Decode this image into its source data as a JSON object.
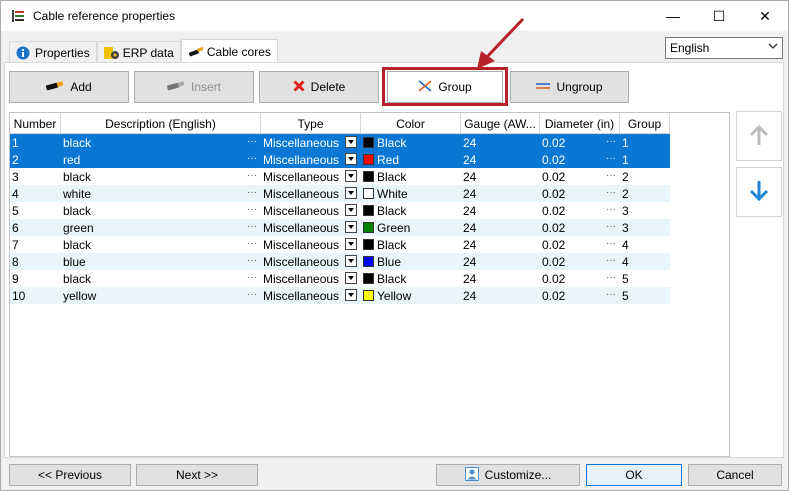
{
  "window": {
    "title": "Cable reference properties",
    "minimize": "—",
    "maximize": "☐",
    "close": "✕"
  },
  "tabs": [
    {
      "label": "Properties",
      "icon": "info-icon"
    },
    {
      "label": "ERP data",
      "icon": "gear-icon"
    },
    {
      "label": "Cable cores",
      "icon": "cable-icon"
    }
  ],
  "language": {
    "selected": "English"
  },
  "toolbar": {
    "add": "Add",
    "insert": "Insert",
    "delete": "Delete",
    "group": "Group",
    "ungroup": "Ungroup"
  },
  "columns": [
    "Number",
    "Description (English)",
    "Type",
    "Color",
    "Gauge (AW...",
    "Diameter (in)",
    "Group"
  ],
  "rows": [
    {
      "number": "1",
      "description": "black",
      "type": "Miscellaneous",
      "color": "Black",
      "swatch": "#000000",
      "gauge": "24",
      "diameter": "0.02",
      "group": "1",
      "selected": true
    },
    {
      "number": "2",
      "description": "red",
      "type": "Miscellaneous",
      "color": "Red",
      "swatch": "#ff0000",
      "gauge": "24",
      "diameter": "0.02",
      "group": "1",
      "selected": true
    },
    {
      "number": "3",
      "description": "black",
      "type": "Miscellaneous",
      "color": "Black",
      "swatch": "#000000",
      "gauge": "24",
      "diameter": "0.02",
      "group": "2",
      "selected": false
    },
    {
      "number": "4",
      "description": "white",
      "type": "Miscellaneous",
      "color": "White",
      "swatch": "#ffffff",
      "gauge": "24",
      "diameter": "0.02",
      "group": "2",
      "selected": false
    },
    {
      "number": "5",
      "description": "black",
      "type": "Miscellaneous",
      "color": "Black",
      "swatch": "#000000",
      "gauge": "24",
      "diameter": "0.02",
      "group": "3",
      "selected": false
    },
    {
      "number": "6",
      "description": "green",
      "type": "Miscellaneous",
      "color": "Green",
      "swatch": "#008000",
      "gauge": "24",
      "diameter": "0.02",
      "group": "3",
      "selected": false
    },
    {
      "number": "7",
      "description": "black",
      "type": "Miscellaneous",
      "color": "Black",
      "swatch": "#000000",
      "gauge": "24",
      "diameter": "0.02",
      "group": "4",
      "selected": false
    },
    {
      "number": "8",
      "description": "blue",
      "type": "Miscellaneous",
      "color": "Blue",
      "swatch": "#0000ff",
      "gauge": "24",
      "diameter": "0.02",
      "group": "4",
      "selected": false
    },
    {
      "number": "9",
      "description": "black",
      "type": "Miscellaneous",
      "color": "Black",
      "swatch": "#000000",
      "gauge": "24",
      "diameter": "0.02",
      "group": "5",
      "selected": false
    },
    {
      "number": "10",
      "description": "yellow",
      "type": "Miscellaneous",
      "color": "Yellow",
      "swatch": "#ffff00",
      "gauge": "24",
      "diameter": "0.02",
      "group": "5",
      "selected": false
    }
  ],
  "footer": {
    "previous": "<< Previous",
    "next": "Next >>",
    "customize": "Customize...",
    "ok": "OK",
    "cancel": "Cancel"
  },
  "colors": {
    "selection": "#0a77d4",
    "alt_row": "#e8f6fb",
    "annotation": "#b7222a"
  }
}
